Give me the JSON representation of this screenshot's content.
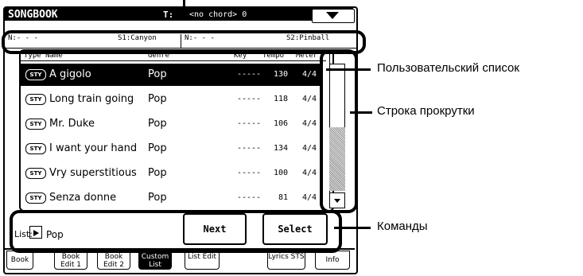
{
  "screen": {
    "title": "SONGBOOK",
    "tempo_label": "T:",
    "chord_label": "<no chord> 0"
  },
  "song_row": {
    "s1_left": "N:- - -",
    "s1": "S1:Canyon",
    "s2_left": "N:- - -",
    "s2": "S2:Pinball"
  },
  "table": {
    "columns": [
      "Type Name",
      "Genre",
      "Key",
      "Tempo",
      "Meter"
    ],
    "rows": [
      {
        "type": "STY",
        "name": "A gigolo",
        "genre": "Pop",
        "key": "-----",
        "tempo": "130",
        "meter": "4/4",
        "selected": true
      },
      {
        "type": "STY",
        "name": "Long train going",
        "genre": "Pop",
        "key": "-----",
        "tempo": "118",
        "meter": "4/4"
      },
      {
        "type": "STY",
        "name": "Mr. Duke",
        "genre": "Pop",
        "key": "-----",
        "tempo": "106",
        "meter": "4/4"
      },
      {
        "type": "STY",
        "name": "I want your hand",
        "genre": "Pop",
        "key": "-----",
        "tempo": "134",
        "meter": "4/4"
      },
      {
        "type": "STY",
        "name": "Vry superstitious",
        "genre": "Pop",
        "key": "-----",
        "tempo": "100",
        "meter": "4/4"
      },
      {
        "type": "STY",
        "name": "Senza donne",
        "genre": "Pop",
        "key": "-----",
        "tempo": "81",
        "meter": "4/4"
      }
    ]
  },
  "commands": {
    "list_label": "List:",
    "list_value": "Pop",
    "next": "Next",
    "select": "Select"
  },
  "tabs": [
    "Book",
    "Book Edit 1",
    "Book Edit 2",
    "Custom List",
    "List Edit",
    "Lyrics STS",
    "Info"
  ],
  "annotations": {
    "custom_list": "Пользовательский список",
    "scrollbar": "Строка прокрутки",
    "commands": "Команды"
  }
}
